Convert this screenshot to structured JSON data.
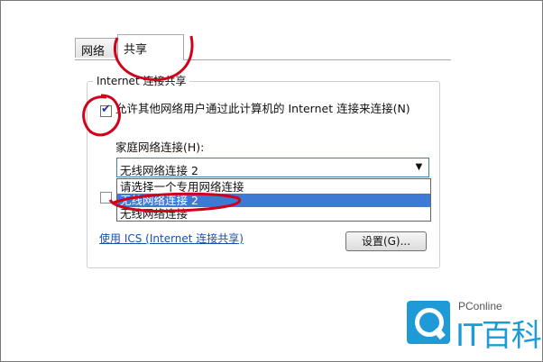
{
  "tabs": [
    {
      "label": "网络",
      "active": false
    },
    {
      "label": "共享",
      "active": true
    }
  ],
  "group_title": "Internet 连接共享",
  "allow_checkbox": {
    "checked": true,
    "label": "允许其他网络用户通过此计算机的 Internet 连接来连接(N)"
  },
  "home_connection": {
    "label": "家庭网络连接(H):",
    "selected": "无线网络连接 2",
    "options": [
      "请选择一个专用网络连接",
      "无线网络连接 2",
      "无线网络连接"
    ],
    "highlighted_index": 1
  },
  "control_checkbox": {
    "checked": false
  },
  "ics_link": "使用 ICS (Internet 连接共享)",
  "settings_button": "设置(G)...",
  "watermark": {
    "brand": "PConline",
    "name": "IT百科"
  },
  "colors": {
    "accent": "#3d7ad6",
    "link": "#1a4fb0",
    "annotation": "#d0021b",
    "logo": "#1e9bd7"
  }
}
